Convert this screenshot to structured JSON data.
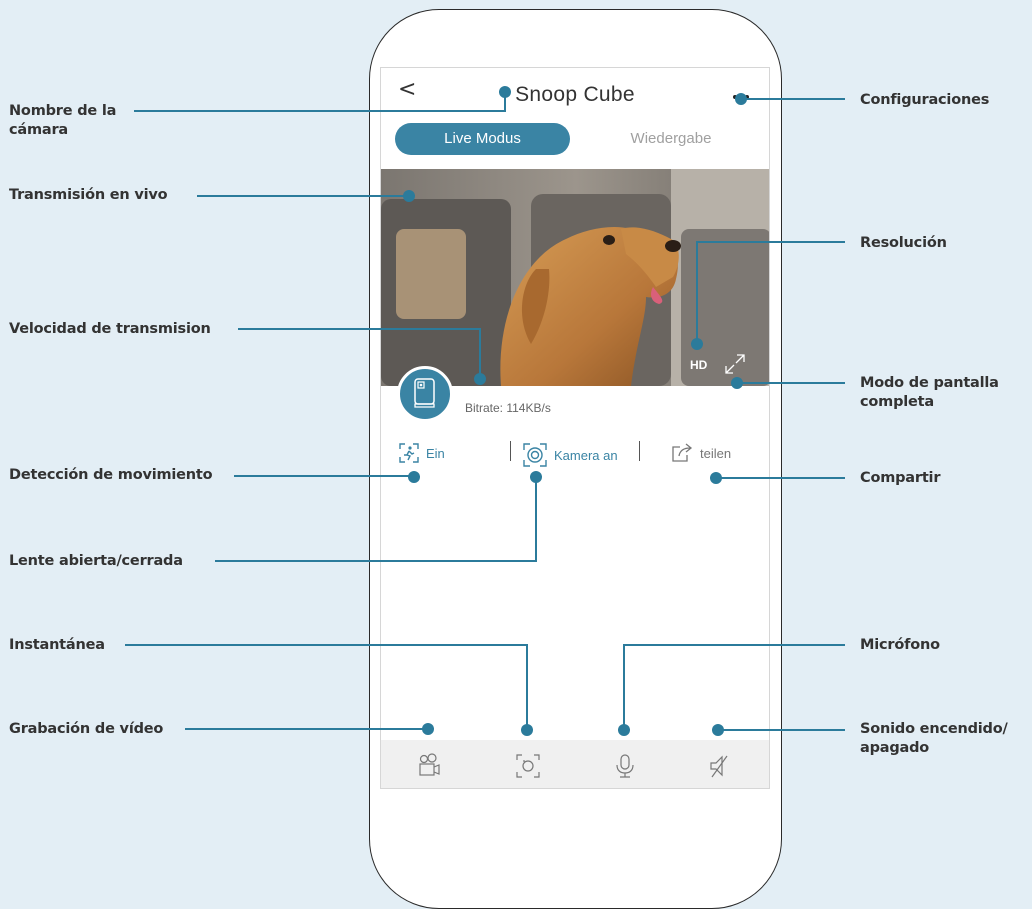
{
  "app": {
    "title": "Snoop Cube",
    "back_glyph": "<",
    "tabs": {
      "live": "Live Modus",
      "playback": "Wiedergabe"
    },
    "video": {
      "resolution": "HD",
      "bitrate": "Bitrate: 114KB/s"
    },
    "actions": {
      "motion": "Ein",
      "camera": "Kamera an",
      "share": "teilen"
    },
    "bottom_bar": [
      "video-record-icon",
      "snapshot-icon",
      "microphone-icon",
      "sound-off-icon"
    ]
  },
  "labels": {
    "camera_name": "Nombre de la\ncámara",
    "live_stream": "Transmisión en vivo",
    "bitrate": "Velocidad de transmision",
    "motion": "Detección de movimiento",
    "lens": "Lente abierta/cerrada",
    "snapshot": "Instantánea",
    "video_record": "Grabación de vídeo",
    "settings": "Configuraciones",
    "resolution": "Resolución",
    "fullscreen": "Modo de pantalla\ncompleta",
    "share": "Compartir",
    "microphone": "Micrófono",
    "sound": "Sonido encendido/\napagado"
  },
  "colors": {
    "accent": "#3a84a4",
    "background": "#e3eef5",
    "callout": "#2b7b9b"
  }
}
